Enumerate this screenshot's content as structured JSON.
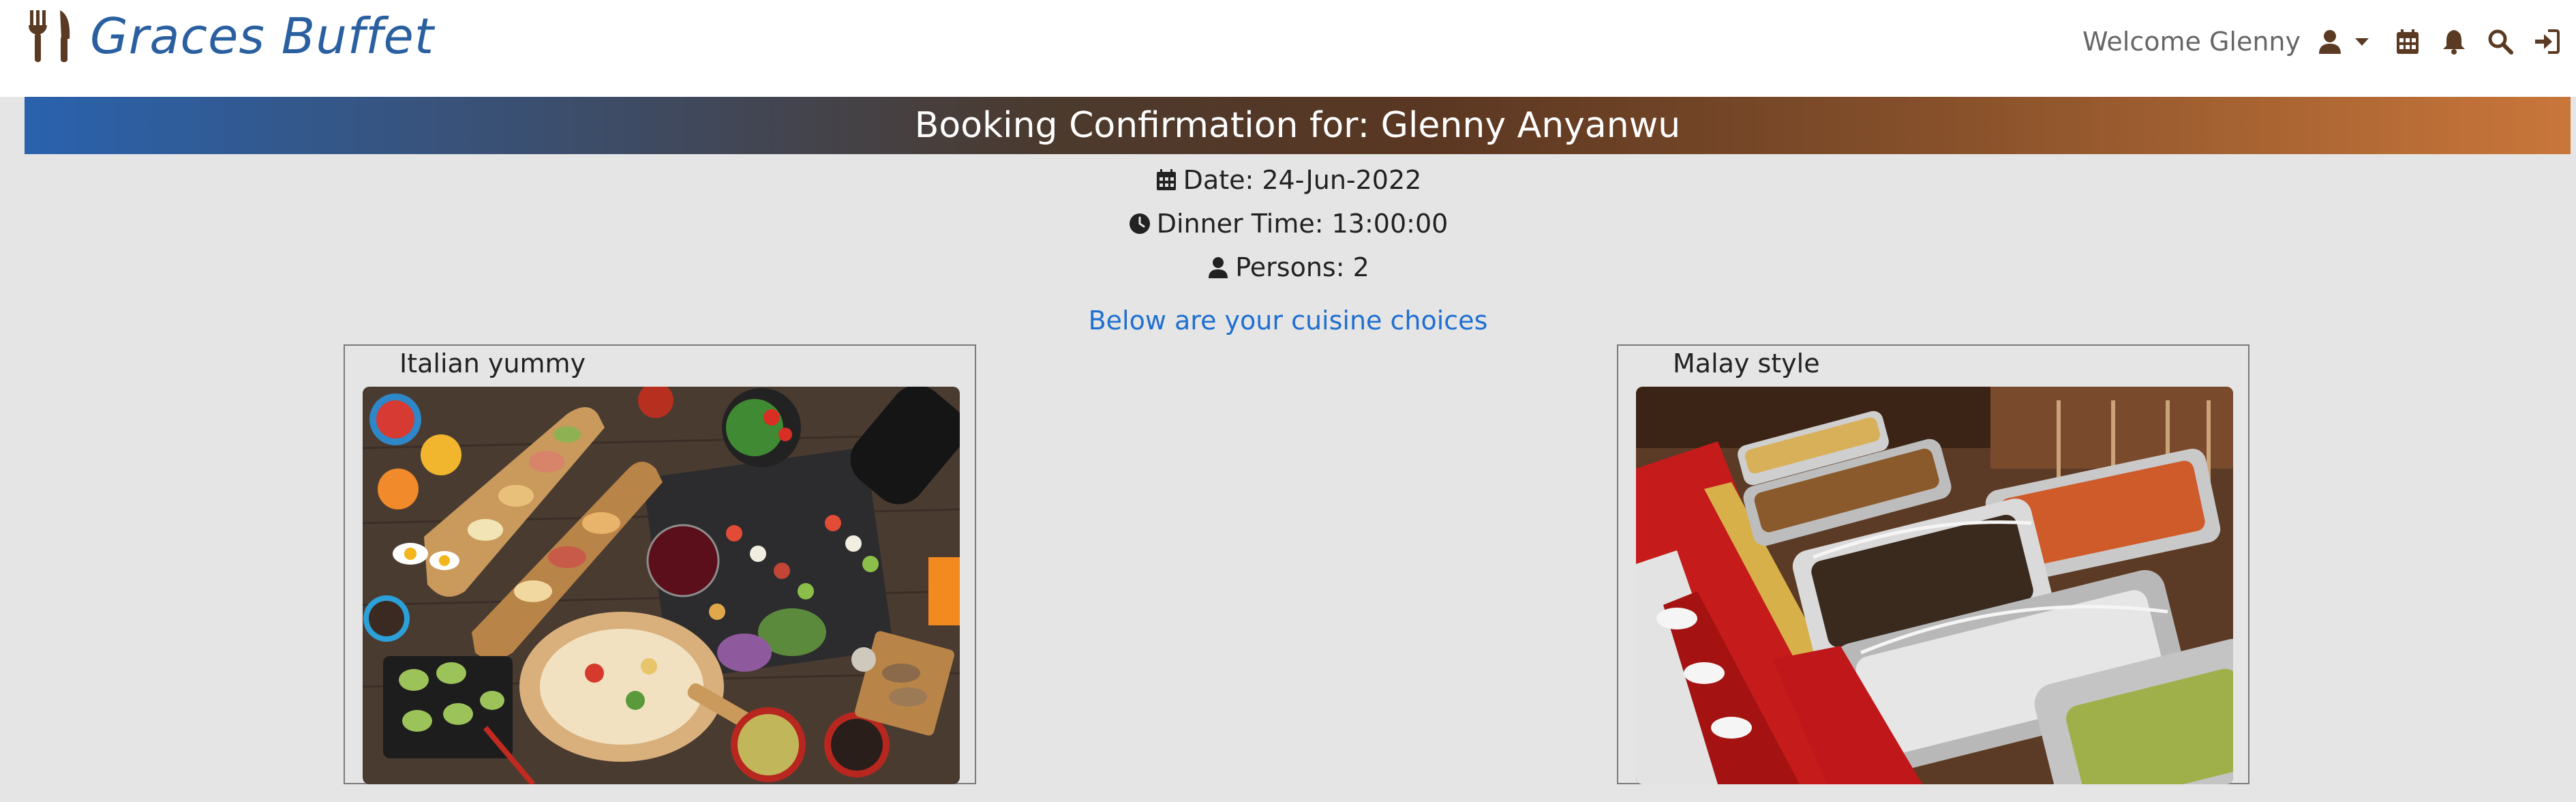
{
  "navbar": {
    "brand_name": "Graces Buffet",
    "brand_icon": "utensils-icon",
    "welcome_text": "Welcome Glenny",
    "icons": [
      "user-icon",
      "calendar-icon",
      "bell-icon",
      "search-icon",
      "sign-in-icon"
    ],
    "icon_color": "#5a3a22",
    "brand_color": "#2a5fa0"
  },
  "banner": {
    "title": "Booking Confirmation for: Glenny Anyanwu",
    "gradient_start": "#2a62ad",
    "gradient_end": "#c9763a"
  },
  "booking": {
    "date_text": "Date: 24-Jun-2022",
    "time_text": "Dinner Time: 13:00:00",
    "persons_text": "Persons: 2"
  },
  "choices_note": "Below are your cuisine choices",
  "cuisines": [
    {
      "label": "Italian yummy",
      "image": "italian-food-photo"
    },
    {
      "label": "Malay style",
      "image": "malay-buffet-photo"
    }
  ]
}
